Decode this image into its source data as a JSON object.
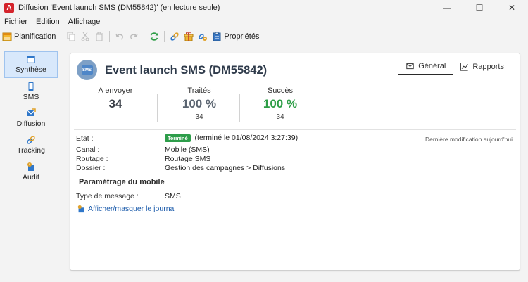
{
  "window": {
    "title": "Diffusion 'Event launch SMS (DM55842)' (en lecture seule)",
    "app_icon_letter": "A",
    "controls": {
      "minimize": "—",
      "maximize": "☐",
      "close": "✕"
    }
  },
  "menu": [
    "Fichier",
    "Edition",
    "Affichage"
  ],
  "toolbar": {
    "planification_label": "Planification",
    "proprietes_label": "Propriétés"
  },
  "nav": {
    "items": [
      {
        "label": "Synthèse",
        "icon": "window-icon",
        "active": true
      },
      {
        "label": "SMS",
        "icon": "mobile-icon",
        "active": false
      },
      {
        "label": "Diffusion",
        "icon": "send-mail-icon",
        "active": false
      },
      {
        "label": "Tracking",
        "icon": "tracking-link-icon",
        "active": false
      },
      {
        "label": "Audit",
        "icon": "audit-icon",
        "active": false
      }
    ]
  },
  "header": {
    "badge_text": "SMS",
    "title": "Event launch SMS (DM55842)",
    "tabs": [
      {
        "label": "Général",
        "icon": "envelope-icon",
        "active": true
      },
      {
        "label": "Rapports",
        "icon": "chart-line-icon",
        "active": false
      }
    ]
  },
  "stats": [
    {
      "label": "A envoyer",
      "value": "34",
      "sub": "",
      "color": "#3a3f48"
    },
    {
      "label": "Traités",
      "value": "100 %",
      "sub": "34",
      "color": "#5a6470"
    },
    {
      "label": "Succès",
      "value": "100 %",
      "sub": "34",
      "color": "#2e9e47"
    }
  ],
  "info": {
    "etat_label": "Etat :",
    "etat_badge": "Terminé",
    "etat_text": "(terminé le 01/08/2024 3:27:39)",
    "last_modified": "Dernière modification aujourd'hui",
    "canal_label": "Canal :",
    "canal_value": "Mobile (SMS)",
    "routage_label": "Routage :",
    "routage_value": "Routage SMS",
    "dossier_label": "Dossier :",
    "dossier_value": "Gestion des campagnes > Diffusions"
  },
  "mobile": {
    "section_title": "Paramétrage du mobile",
    "type_label": "Type de message :",
    "type_value": "SMS",
    "journal_link": "Afficher/masquer le journal"
  },
  "colors": {
    "accent_blue": "#1b5bab",
    "success_green": "#2e9e47",
    "brand_red": "#d4232b"
  }
}
